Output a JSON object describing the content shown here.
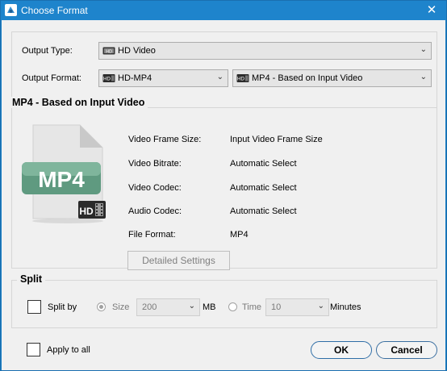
{
  "window": {
    "title": "Choose Format",
    "close_glyph": "✕"
  },
  "output_type": {
    "label": "Output Type:",
    "value": "HD Video",
    "icon": "hd-video-icon"
  },
  "output_format": {
    "label": "Output Format:",
    "category": {
      "value": "HD-MP4",
      "icon": "hd-format-icon"
    },
    "format": {
      "value": "MP4 - Based on Input Video",
      "icon": "hd-format-icon"
    }
  },
  "profile": {
    "title": "MP4 - Based on Input Video",
    "thumbnail_text": "MP4",
    "thumbnail_badge": "HD",
    "rows": [
      {
        "label": "Video Frame Size:",
        "value": "Input Video Frame Size"
      },
      {
        "label": "Video Bitrate:",
        "value": "Automatic Select"
      },
      {
        "label": "Video Codec:",
        "value": "Automatic Select"
      },
      {
        "label": "Audio Codec:",
        "value": "Automatic Select"
      },
      {
        "label": "File Format:",
        "value": "MP4"
      }
    ],
    "detailed_settings_label": "Detailed Settings"
  },
  "split": {
    "title": "Split",
    "split_by_label": "Split by",
    "split_by_checked": false,
    "size": {
      "label": "Size",
      "value": "200",
      "unit": "MB",
      "selected": true
    },
    "time": {
      "label": "Time",
      "value": "10",
      "unit": "Minutes",
      "selected": false
    }
  },
  "footer": {
    "apply_to_all_label": "Apply to all",
    "apply_to_all_checked": false,
    "ok_label": "OK",
    "cancel_label": "Cancel"
  },
  "colors": {
    "titlebar": "#1e84cc",
    "accent": "#2f6ea7",
    "thumbnail_band": "#5f9a80"
  }
}
